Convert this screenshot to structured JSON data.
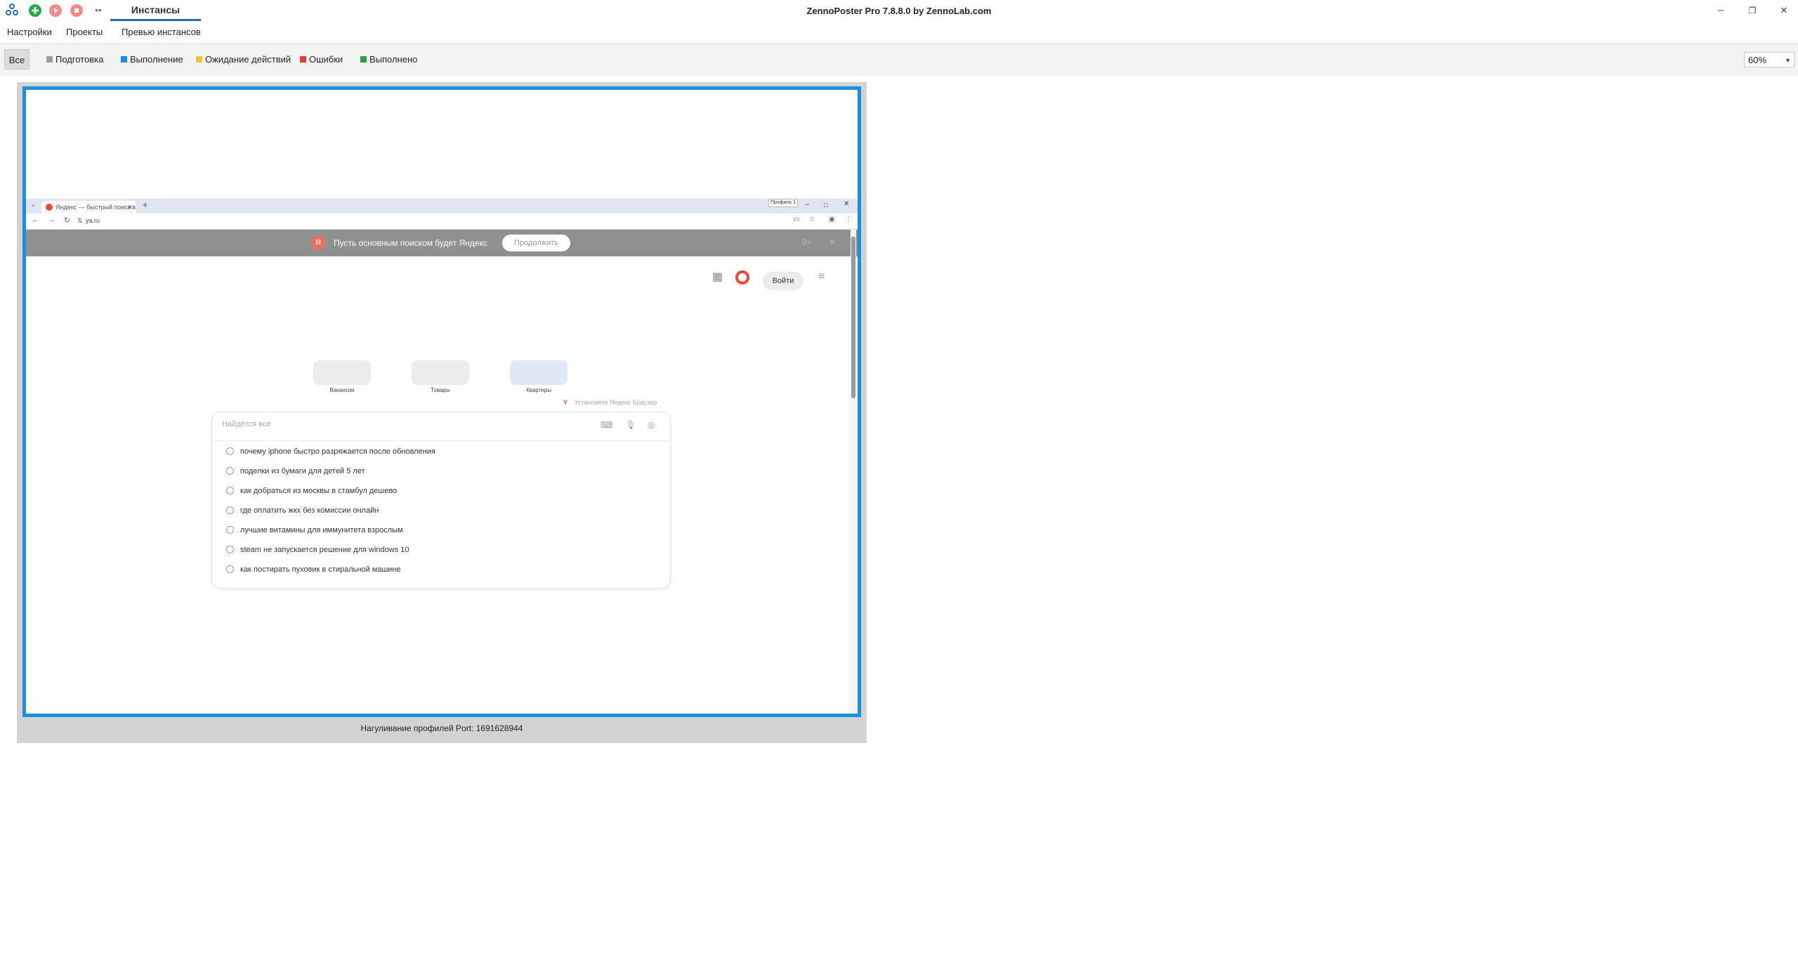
{
  "titlebar": {
    "app_title": "ZennoPoster Pro 7.8.8.0 by ZennoLab.com",
    "tab_active": "Инстансы",
    "more_glyph": "••",
    "window_buttons": [
      "–",
      "❐",
      "✕"
    ]
  },
  "menu": {
    "items": [
      "Настройки",
      "Проекты",
      "Превью инстансов"
    ]
  },
  "filters": {
    "all": "Все",
    "items": [
      {
        "label": "Подготовка",
        "color": "#9e9e9e"
      },
      {
        "label": "Выполнение",
        "color": "#1e88e5"
      },
      {
        "label": "Ожидание действий",
        "color": "#f2c12e"
      },
      {
        "label": "Ошибки",
        "color": "#e53935"
      },
      {
        "label": "Выполнено",
        "color": "#2e9e44"
      }
    ],
    "zoom": "60%"
  },
  "instance": {
    "label": "Нагуливание профилей Port: 1691628944",
    "browser": {
      "tab_title": "Яндекс — быстрый поиск в и...",
      "profile_badge": "Профиль 1",
      "address": "ya.ru",
      "banner_text": "Пусть основным поиском будет Яндекс",
      "banner_button": "Продолжить",
      "banner_extra": "0+",
      "login_button": "Войти",
      "tiles": [
        "Вакансии",
        "Товары",
        "Квартиры"
      ],
      "install_text": "Установите Яндекс Браузер",
      "search_placeholder": "Найдётся всё",
      "suggestions": [
        "почему iphone быстро разряжается после обновления",
        "поделки из бумаги для детей 5 лет",
        "как добраться из москвы в стамбул дешево",
        "где оплатить жкх без комиссии онлайн",
        "лучшие витамины для иммунитета взрослым",
        "steam не запускается решение для windows 10",
        "как постирать пуховик в стиральной машине"
      ]
    }
  },
  "colors": {
    "accent": "#1a8fe0",
    "tab_underline": "#2c6bb0"
  }
}
